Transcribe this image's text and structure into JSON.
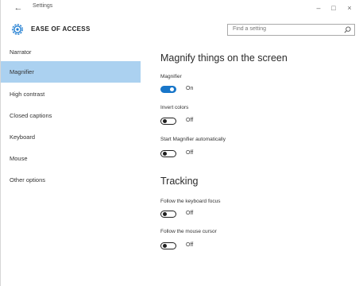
{
  "window": {
    "title": "Settings",
    "back_glyph": "←",
    "minimize_glyph": "–",
    "maximize_glyph": "□",
    "close_glyph": "×"
  },
  "header": {
    "icon": "gear-icon",
    "title": "EASE OF ACCESS",
    "search_placeholder": "Find a setting"
  },
  "sidebar": {
    "items": [
      {
        "label": "Narrator",
        "active": false
      },
      {
        "label": "Magnifier",
        "active": true
      },
      {
        "label": "High contrast",
        "active": false
      },
      {
        "label": "Closed captions",
        "active": false
      },
      {
        "label": "Keyboard",
        "active": false
      },
      {
        "label": "Mouse",
        "active": false
      },
      {
        "label": "Other options",
        "active": false
      }
    ]
  },
  "main": {
    "section1_title": "Magnify things on the screen",
    "magnifier": {
      "label": "Magnifier",
      "state": "On",
      "on": true
    },
    "invert_colors": {
      "label": "Invert colors",
      "state": "Off",
      "on": false
    },
    "start_auto": {
      "label": "Start Magnifier automatically",
      "state": "Off",
      "on": false
    },
    "section2_title": "Tracking",
    "follow_keyboard": {
      "label": "Follow the keyboard focus",
      "state": "Off",
      "on": false
    },
    "follow_mouse": {
      "label": "Follow the mouse cursor",
      "state": "Off",
      "on": false
    }
  },
  "colors": {
    "accent": "#1876c9",
    "selected_nav": "#abd1f0"
  }
}
